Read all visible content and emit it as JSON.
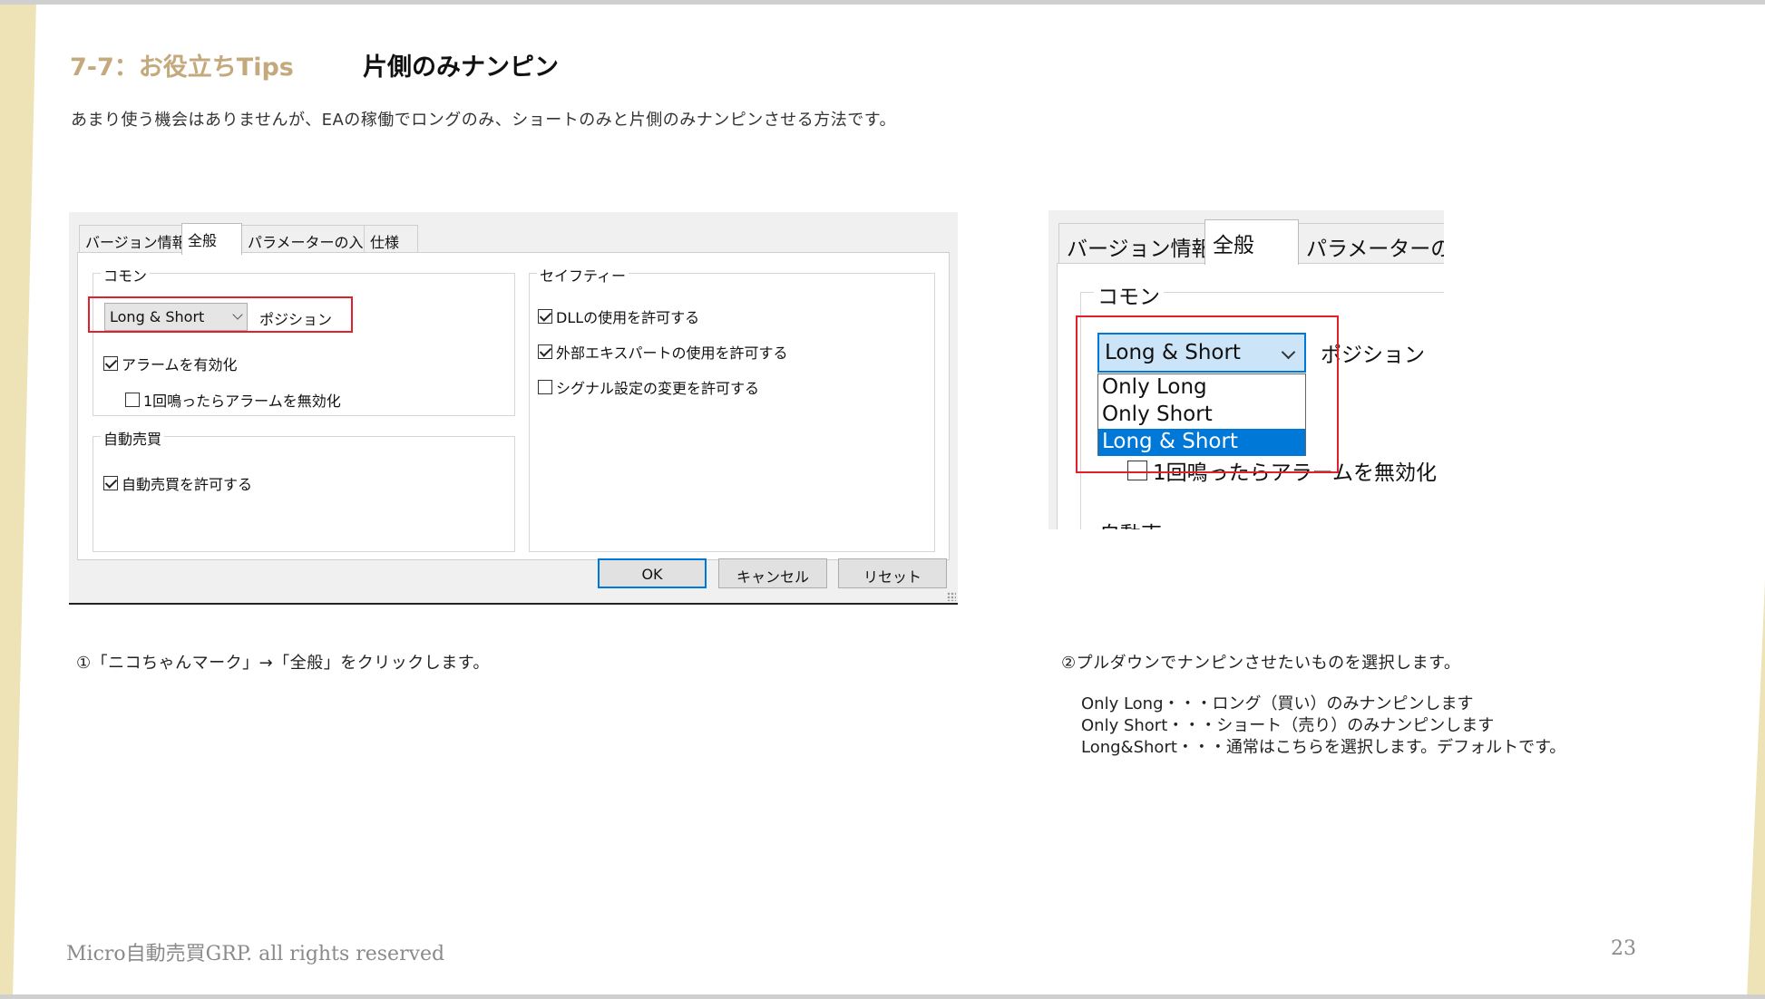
{
  "slide": {
    "title_number": "7-7：お役立ちTips",
    "title": "片側のみナンピン",
    "subtitle": "あまり使う機会はありませんが、EAの稼働でロングのみ、ショートのみと片側のみナンピンさせる方法です。",
    "footer": "Micro自動売買GRP. all rights reserved",
    "page_number": "23",
    "accent_color": "#c4a97c",
    "highlight_color": "#e0202a"
  },
  "dialog1": {
    "tabs": [
      "バージョン情報",
      "全般",
      "パラメーターの入力",
      "仕様"
    ],
    "active_tab": "全般",
    "common": {
      "label": "コモン",
      "select_value": "Long & Short",
      "position_label": "ポジション",
      "alert_enable": "アラームを有効化",
      "alert_once": "1回鳴ったらアラームを無効化"
    },
    "auto": {
      "label": "自動売買",
      "allow": "自動売買を許可する"
    },
    "safety": {
      "label": "セイフティー",
      "allow_dll": "DLLの使用を許可する",
      "allow_ea": "外部エキスパートの使用を許可する",
      "allow_signal": "シグナル設定の変更を許可する"
    },
    "buttons": {
      "ok": "OK",
      "cancel": "キャンセル",
      "reset": "リセット"
    }
  },
  "dialog2": {
    "tabs": [
      "バージョン情報",
      "全般",
      "パラメーターの入力"
    ],
    "common_label": "コモン",
    "select_value": "Long & Short",
    "position_label": "ポジション",
    "options": [
      "Only Long",
      "Only Short",
      "Long & Short"
    ],
    "selected_option": "Long & Short",
    "bg_checkbox_label": "1回鳴ったらアラームを無効化",
    "cut_text": "自動売買"
  },
  "captions": {
    "step1": "①「ニコちゃんマーク」→「全般」をクリックします。",
    "step2": "②プルダウンでナンピンさせたいものを選択します。",
    "line1": "Only Long・・・ロング（買い）のみナンピンします",
    "line2": "Only Short・・・ショート（売り）のみナンピンします",
    "line3": "Long&Short・・・通常はこちらを選択します。デフォルトです。"
  }
}
